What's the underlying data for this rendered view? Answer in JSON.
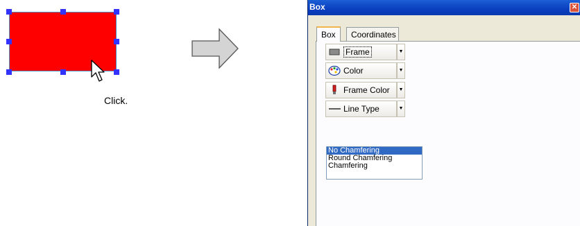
{
  "illustration": {
    "shape_color": "#ff0000",
    "handle_color": "#3333ff",
    "caption": "Click."
  },
  "window": {
    "title": "Box",
    "close_glyph": "✕",
    "tabs": [
      {
        "label": "Box",
        "active": true
      },
      {
        "label": "Coordinates",
        "active": false
      }
    ],
    "toolbar": [
      {
        "label": "Frame",
        "icon": "frame-rect-icon"
      },
      {
        "label": "Color",
        "icon": "palette-icon"
      },
      {
        "label": "Frame Color",
        "icon": "brush-icon"
      },
      {
        "label": "Line Type",
        "icon": "line-icon"
      }
    ],
    "dropdown_glyph": "▼",
    "chamfer_list": {
      "items": [
        "No Chamfering",
        "Round Chamfering",
        "Chamfering"
      ],
      "selected_index": 0
    }
  },
  "colors": {
    "titlebar": "#0a3fbf",
    "selection": "#316ac5",
    "panel_bg": "#ece9d8"
  }
}
